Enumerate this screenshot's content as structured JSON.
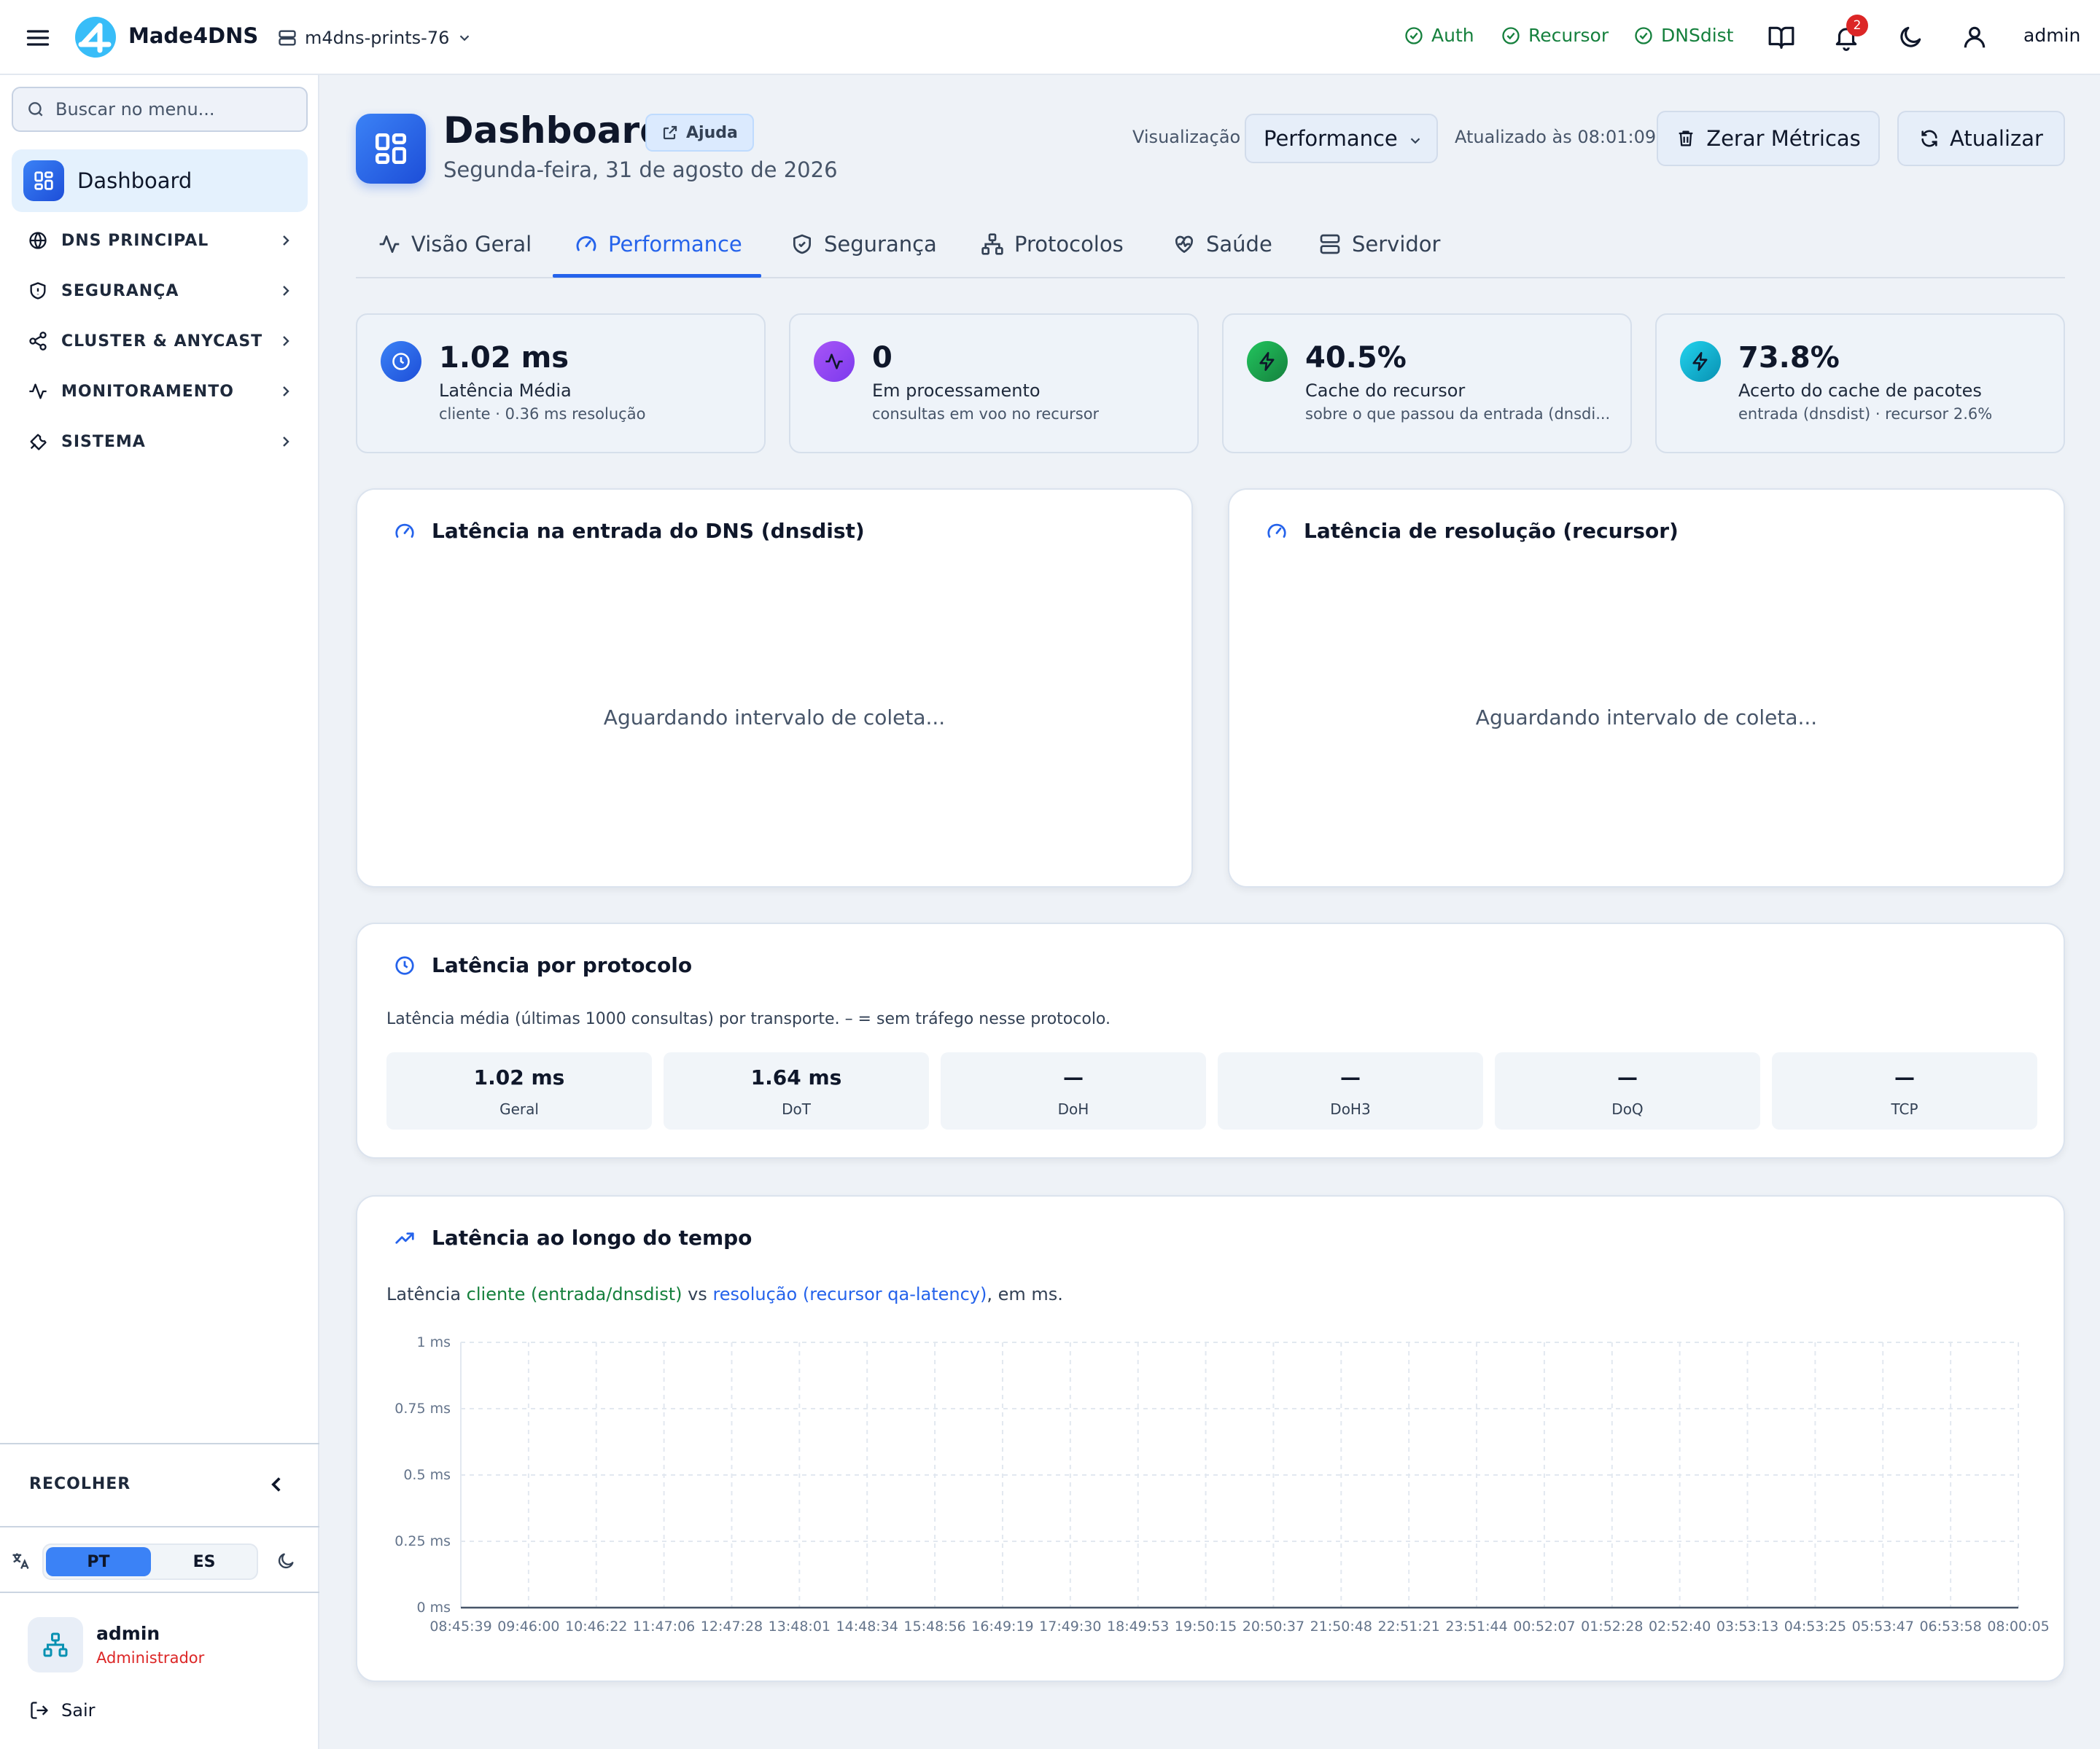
{
  "app": {
    "name": "Made4DNS",
    "server": "m4dns-prints-76",
    "admin_label": "admin",
    "notif_count": "2"
  },
  "status": [
    {
      "label": "Auth"
    },
    {
      "label": "Recursor"
    },
    {
      "label": "DNSdist"
    }
  ],
  "sidebar": {
    "search_placeholder": "Buscar no menu...",
    "active": "Dashboard",
    "items": [
      {
        "label": "DNS PRINCIPAL",
        "icon": "globe-icon"
      },
      {
        "label": "SEGURANÇA",
        "icon": "shield-icon"
      },
      {
        "label": "CLUSTER & ANYCAST",
        "icon": "share-icon"
      },
      {
        "label": "MONITORAMENTO",
        "icon": "activity-icon"
      },
      {
        "label": "SISTEMA",
        "icon": "wrench-icon"
      }
    ],
    "collapse": "RECOLHER",
    "lang_pt": "PT",
    "lang_es": "ES",
    "user_name": "admin",
    "user_role": "Administrador",
    "logout": "Sair"
  },
  "header": {
    "title": "Dashboard",
    "help": "Ajuda",
    "date": "Segunda-feira, 31 de agosto de 2026",
    "vis_label": "Visualização",
    "vis_value": "Performance",
    "updated": "Atualizado às 08:01:09",
    "reset": "Zerar Métricas",
    "refresh": "Atualizar"
  },
  "tabs": [
    {
      "label": "Visão Geral"
    },
    {
      "label": "Performance",
      "active": true
    },
    {
      "label": "Segurança"
    },
    {
      "label": "Protocolos"
    },
    {
      "label": "Saúde"
    },
    {
      "label": "Servidor"
    }
  ],
  "stats": [
    {
      "value": "1.02 ms",
      "label": "Latência Média",
      "sub": "cliente · 0.36 ms resolução",
      "color": "#2563eb"
    },
    {
      "value": "0",
      "label": "Em processamento",
      "sub": "consultas em voo no recursor",
      "color": "#7c3aed"
    },
    {
      "value": "40.5%",
      "label": "Cache do recursor",
      "sub": "sobre o que passou da entrada (dnsdi...",
      "color": "#16a34a"
    },
    {
      "value": "73.8%",
      "label": "Acerto do cache de pacotes",
      "sub": "entrada (dnsdist) · recursor 2.6%",
      "color": "#0891b2"
    }
  ],
  "panels": {
    "dnsdist_title": "Latência na entrada do DNS (dnsdist)",
    "recursor_title": "Latência de resolução (recursor)",
    "waiting": "Aguardando intervalo de coleta...",
    "proto_title": "Latência por protocolo",
    "proto_desc": "Latência média (últimas 1000 consultas) por transporte. – = sem tráfego nesse protocolo.",
    "proto": [
      {
        "value": "1.02 ms",
        "label": "Geral"
      },
      {
        "value": "1.64 ms",
        "label": "DoT"
      },
      {
        "value": "—",
        "label": "DoH"
      },
      {
        "value": "—",
        "label": "DoH3"
      },
      {
        "value": "—",
        "label": "DoQ"
      },
      {
        "value": "—",
        "label": "TCP"
      }
    ],
    "time_title": "Latência ao longo do tempo",
    "time_desc_a": "Latência ",
    "time_desc_b": "cliente (entrada/dnsdist)",
    "time_desc_c": " vs ",
    "time_desc_d": "resolução (recursor qa-latency)",
    "time_desc_e": ", em ms."
  },
  "chart_data": {
    "type": "line",
    "x": [
      "08:45:39",
      "09:46:00",
      "10:46:22",
      "11:47:06",
      "12:47:28",
      "13:48:01",
      "14:48:34",
      "15:48:56",
      "16:49:19",
      "17:49:30",
      "18:49:53",
      "19:50:15",
      "20:50:37",
      "21:50:48",
      "22:51:21",
      "23:51:44",
      "00:52:07",
      "01:52:28",
      "02:52:40",
      "03:53:13",
      "04:53:25",
      "05:53:47",
      "06:53:58",
      "08:00:05"
    ],
    "y_ticks": [
      "1 ms",
      "0.75 ms",
      "0.5 ms",
      "0.25 ms",
      "0 ms"
    ],
    "ylim": [
      0,
      1
    ],
    "grid": true,
    "series": [
      {
        "name": "cliente (entrada/dnsdist)",
        "color": "#15803d",
        "values": [
          0,
          0,
          0,
          0,
          0,
          0,
          0,
          0,
          0,
          0,
          0,
          0,
          0,
          0,
          0,
          0,
          0,
          0,
          0,
          0,
          0,
          0,
          0,
          0
        ]
      },
      {
        "name": "resolução (recursor qa-latency)",
        "color": "#2563eb",
        "values": [
          0,
          0,
          0,
          0,
          0,
          0,
          0,
          0,
          0,
          0,
          0,
          0,
          0,
          0,
          0,
          0,
          0,
          0,
          0,
          0,
          0,
          0,
          0,
          0
        ]
      }
    ]
  }
}
